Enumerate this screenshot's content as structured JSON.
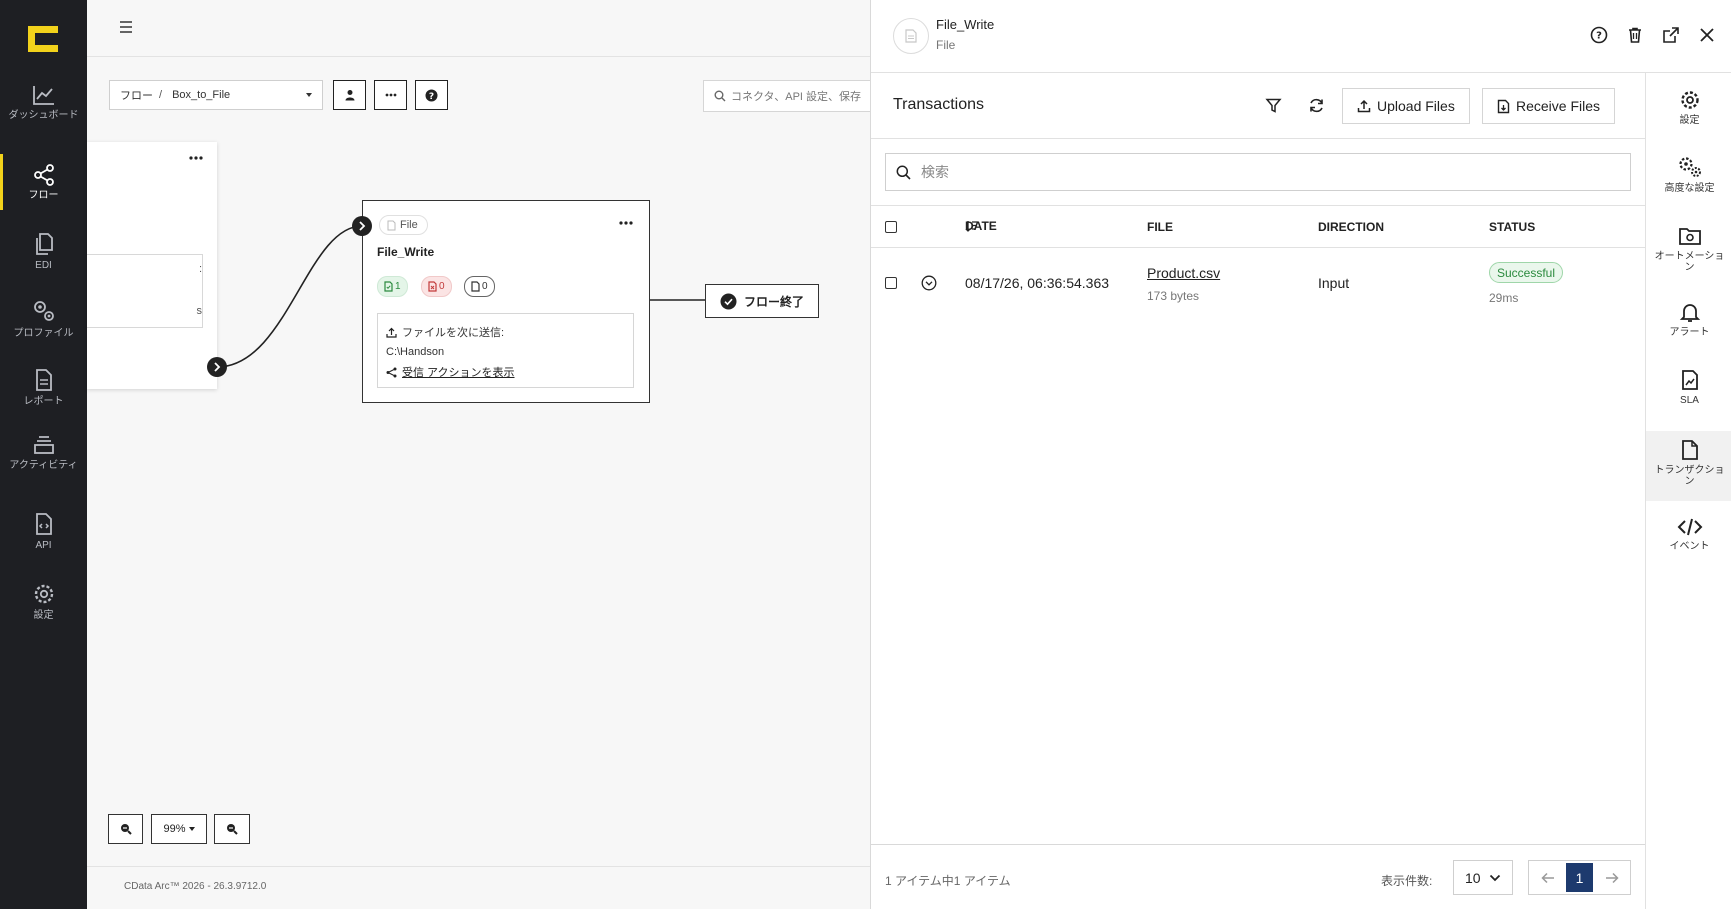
{
  "app": {
    "nav": [
      {
        "key": "dashboard",
        "label": "ダッシュボード"
      },
      {
        "key": "flow",
        "label": "フロー"
      },
      {
        "key": "edi",
        "label": "EDI"
      },
      {
        "key": "profile",
        "label": "プロファイル"
      },
      {
        "key": "report",
        "label": "レポート"
      },
      {
        "key": "activity",
        "label": "アクティビティ"
      },
      {
        "key": "api",
        "label": "API"
      },
      {
        "key": "settings",
        "label": "設定"
      }
    ]
  },
  "canvas": {
    "breadcrumb": {
      "root": "フロー",
      "separator": "/",
      "flow": "Box_to_File"
    },
    "search_placeholder": "コネクタ、API 設定、保存",
    "node_left_fragments": [
      ":",
      "s"
    ],
    "node": {
      "type_label": "File",
      "title": "File_Write",
      "badges": {
        "success": "1",
        "error": "0",
        "pending": "0"
      },
      "send_label": "ファイルを次に送信:",
      "path": "C:\\Handson",
      "receive_link": "受信 アクションを表示"
    },
    "flow_end_label": "フロー終了",
    "zoom_level": "99%",
    "footer": "CData Arc™ 2026 - 26.3.9712.0"
  },
  "panel": {
    "title": "File_Write",
    "subtitle": "File",
    "transactions": {
      "heading": "Transactions",
      "upload_label": "Upload Files",
      "receive_label": "Receive Files",
      "search_placeholder": "検索",
      "columns": {
        "date": "DATE",
        "file": "FILE",
        "direction": "DIRECTION",
        "status": "STATUS"
      },
      "rows": [
        {
          "date": "08/17/26, 06:36:54.363",
          "file": "Product.csv",
          "size": "173 bytes",
          "direction": "Input",
          "status": "Successful",
          "duration": "29ms"
        }
      ],
      "footer": {
        "count_text": "1 アイテム中1 アイテム",
        "per_page_label": "表示件数:",
        "per_page": "10",
        "current_page": "1"
      }
    },
    "sidebar": [
      {
        "key": "settings",
        "label": "設定"
      },
      {
        "key": "advanced",
        "label": "高度な設定"
      },
      {
        "key": "automation",
        "label": "オートメーション"
      },
      {
        "key": "alerts",
        "label": "アラート"
      },
      {
        "key": "sla",
        "label": "SLA"
      },
      {
        "key": "transactions",
        "label": "トランザクション"
      },
      {
        "key": "events",
        "label": "イベント"
      }
    ]
  },
  "colors": {
    "nav_bg": "#1e1f23",
    "accent": "#f2d21b",
    "success": "#2b8a3e",
    "page_active": "#1d3a6e"
  }
}
